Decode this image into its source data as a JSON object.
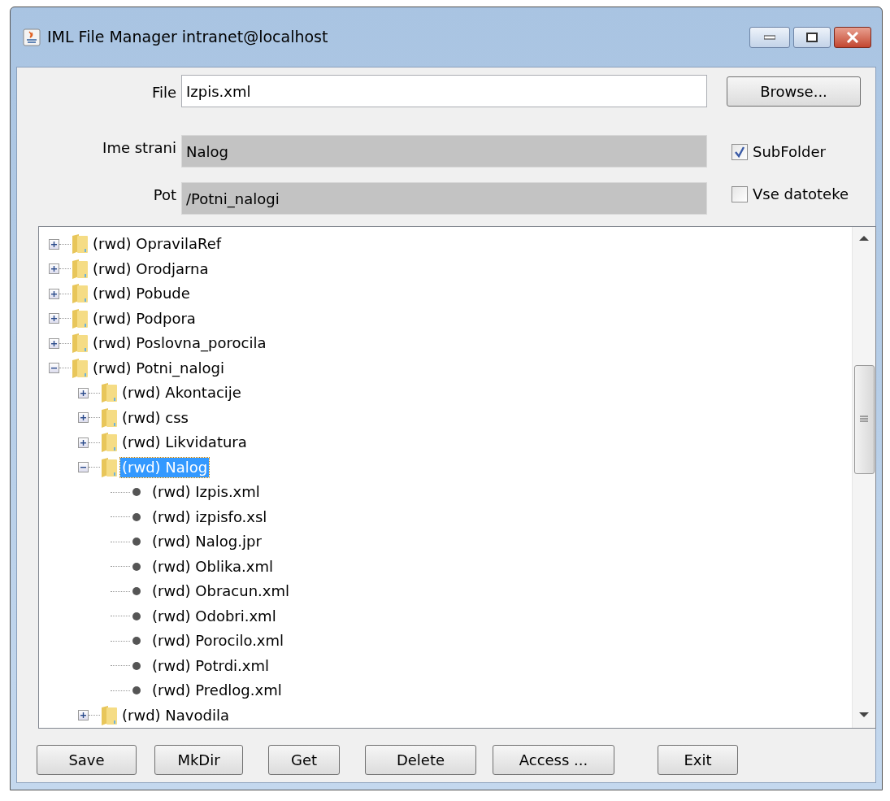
{
  "window": {
    "title": "IML File Manager intranet@localhost"
  },
  "form": {
    "file": {
      "label": "File",
      "value": "Izpis.xml"
    },
    "browse_button": "Browse...",
    "page_name": {
      "label": "Ime strani",
      "value": "Nalog"
    },
    "path": {
      "label": "Pot",
      "value": "/Potni_nalogi"
    },
    "checkboxes": [
      {
        "label": "SubFolder",
        "checked": true
      },
      {
        "label": "Vse datoteke",
        "checked": false
      }
    ]
  },
  "tree": [
    {
      "label": "(rwd) OpravilaRef",
      "kind": "folder",
      "expanded": false,
      "selected": false
    },
    {
      "label": "(rwd) Orodjarna",
      "kind": "folder",
      "expanded": false,
      "selected": false
    },
    {
      "label": "(rwd) Pobude",
      "kind": "folder",
      "expanded": false,
      "selected": false
    },
    {
      "label": "(rwd) Podpora",
      "kind": "folder",
      "expanded": false,
      "selected": false
    },
    {
      "label": "(rwd) Poslovna_porocila",
      "kind": "folder",
      "expanded": false,
      "selected": false
    },
    {
      "label": "(rwd) Potni_nalogi",
      "kind": "folder",
      "expanded": true,
      "selected": false,
      "children": [
        {
          "label": "(rwd) Akontacije",
          "kind": "folder",
          "expanded": false,
          "selected": false
        },
        {
          "label": "(rwd) css",
          "kind": "folder",
          "expanded": false,
          "selected": false
        },
        {
          "label": "(rwd) Likvidatura",
          "kind": "folder",
          "expanded": false,
          "selected": false
        },
        {
          "label": "(rwd) Nalog",
          "kind": "folder",
          "expanded": true,
          "selected": true,
          "children": [
            {
              "label": "(rwd) Izpis.xml",
              "kind": "file",
              "selected": false
            },
            {
              "label": "(rwd) izpisfo.xsl",
              "kind": "file",
              "selected": false
            },
            {
              "label": "(rwd) Nalog.jpr",
              "kind": "file",
              "selected": false
            },
            {
              "label": "(rwd) Oblika.xml",
              "kind": "file",
              "selected": false
            },
            {
              "label": "(rwd) Obracun.xml",
              "kind": "file",
              "selected": false
            },
            {
              "label": "(rwd) Odobri.xml",
              "kind": "file",
              "selected": false
            },
            {
              "label": "(rwd) Porocilo.xml",
              "kind": "file",
              "selected": false
            },
            {
              "label": "(rwd) Potrdi.xml",
              "kind": "file",
              "selected": false
            },
            {
              "label": "(rwd) Predlog.xml",
              "kind": "file",
              "selected": false
            }
          ]
        },
        {
          "label": "(rwd) Navodila",
          "kind": "folder",
          "expanded": false,
          "selected": false
        }
      ]
    }
  ],
  "buttons": [
    "Save",
    "MkDir",
    "Get",
    "Delete",
    "Access ...",
    "Exit"
  ]
}
